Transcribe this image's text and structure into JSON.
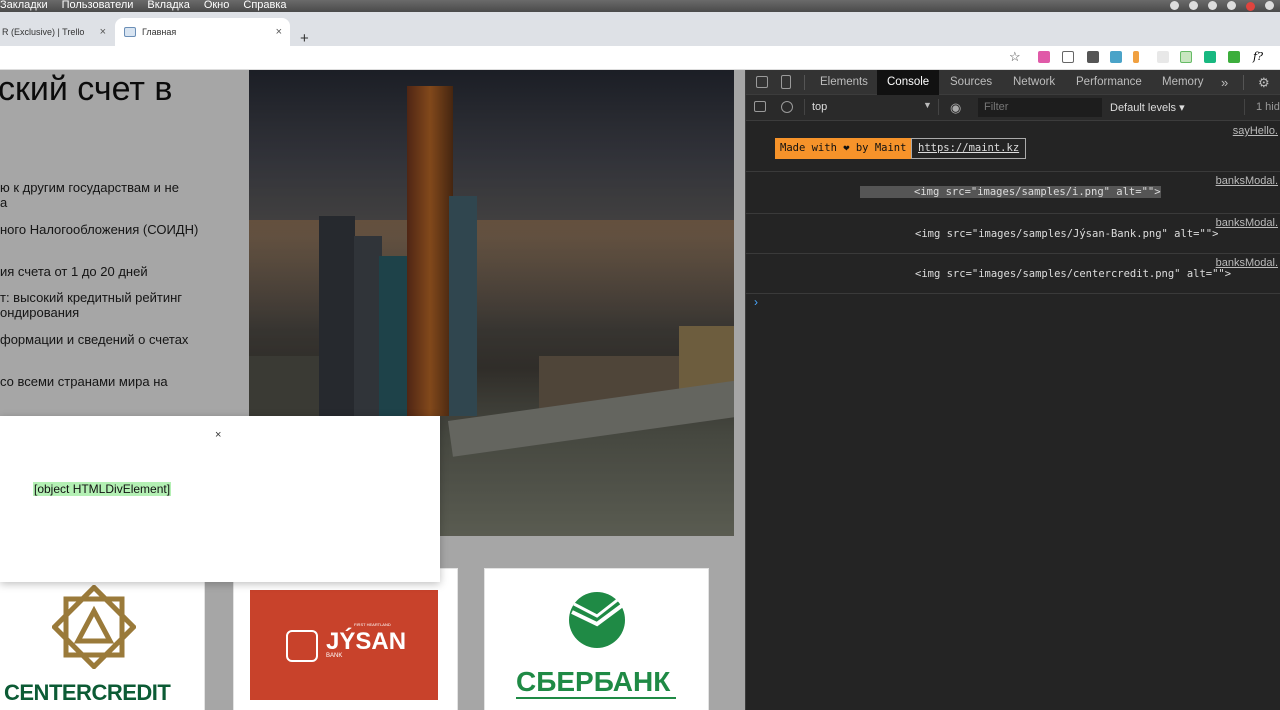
{
  "menubar": {
    "items": [
      "Закладки",
      "Пользователи",
      "Вкладка",
      "Окно",
      "Справка"
    ]
  },
  "tabs": {
    "inactive_label": "R (Exclusive) | Trello",
    "active_label": "Главная",
    "close_glyph": "×",
    "new_tab_glyph": "+"
  },
  "toolbar": {
    "star_glyph": "☆",
    "extension_fq": "f?"
  },
  "page": {
    "heading": "ский счет в",
    "bullets": [
      "ю к другим государствам и не",
      "а",
      "ного Налогообложения (СОИДН)",
      "ия счета от 1 до 20 дней",
      "т: высокий кредитный рейтинг",
      "ондирования",
      "формации и сведений о счетах",
      "со всеми странами мира на"
    ],
    "banks": {
      "centercredit": "CENTERCREDIT",
      "jysan": "JÝSAN",
      "jysan_sub": "BANK",
      "jysan_small": "FIRST HEARTLAND",
      "sber": "СБЕРБАНК"
    }
  },
  "modal": {
    "close_glyph": "×",
    "message": "[object HTMLDivElement]"
  },
  "devtools": {
    "tabs": [
      "Elements",
      "Console",
      "Sources",
      "Network",
      "Performance",
      "Memory"
    ],
    "active_tab": "Console",
    "more_glyph": "»",
    "context": "top",
    "context_arrow": "▼",
    "filter_placeholder": "Filter",
    "levels": "Default levels ▾",
    "hidden_count": "1 hid",
    "logs": [
      {
        "source": "sayHello.",
        "badge": "Made with ❤ by Maint",
        "link": "https://maint.kz"
      },
      {
        "source": "banksModal.",
        "text": "<img src=\"images/samples/i.png\" alt=\"\">"
      },
      {
        "source": "banksModal.",
        "text": "<img src=\"images/samples/Jýsan-Bank.png\" alt=\"\">"
      },
      {
        "source": "banksModal.",
        "text": "<img src=\"images/samples/centercredit.png\" alt=\"\">"
      }
    ],
    "prompt_glyph": "›"
  }
}
